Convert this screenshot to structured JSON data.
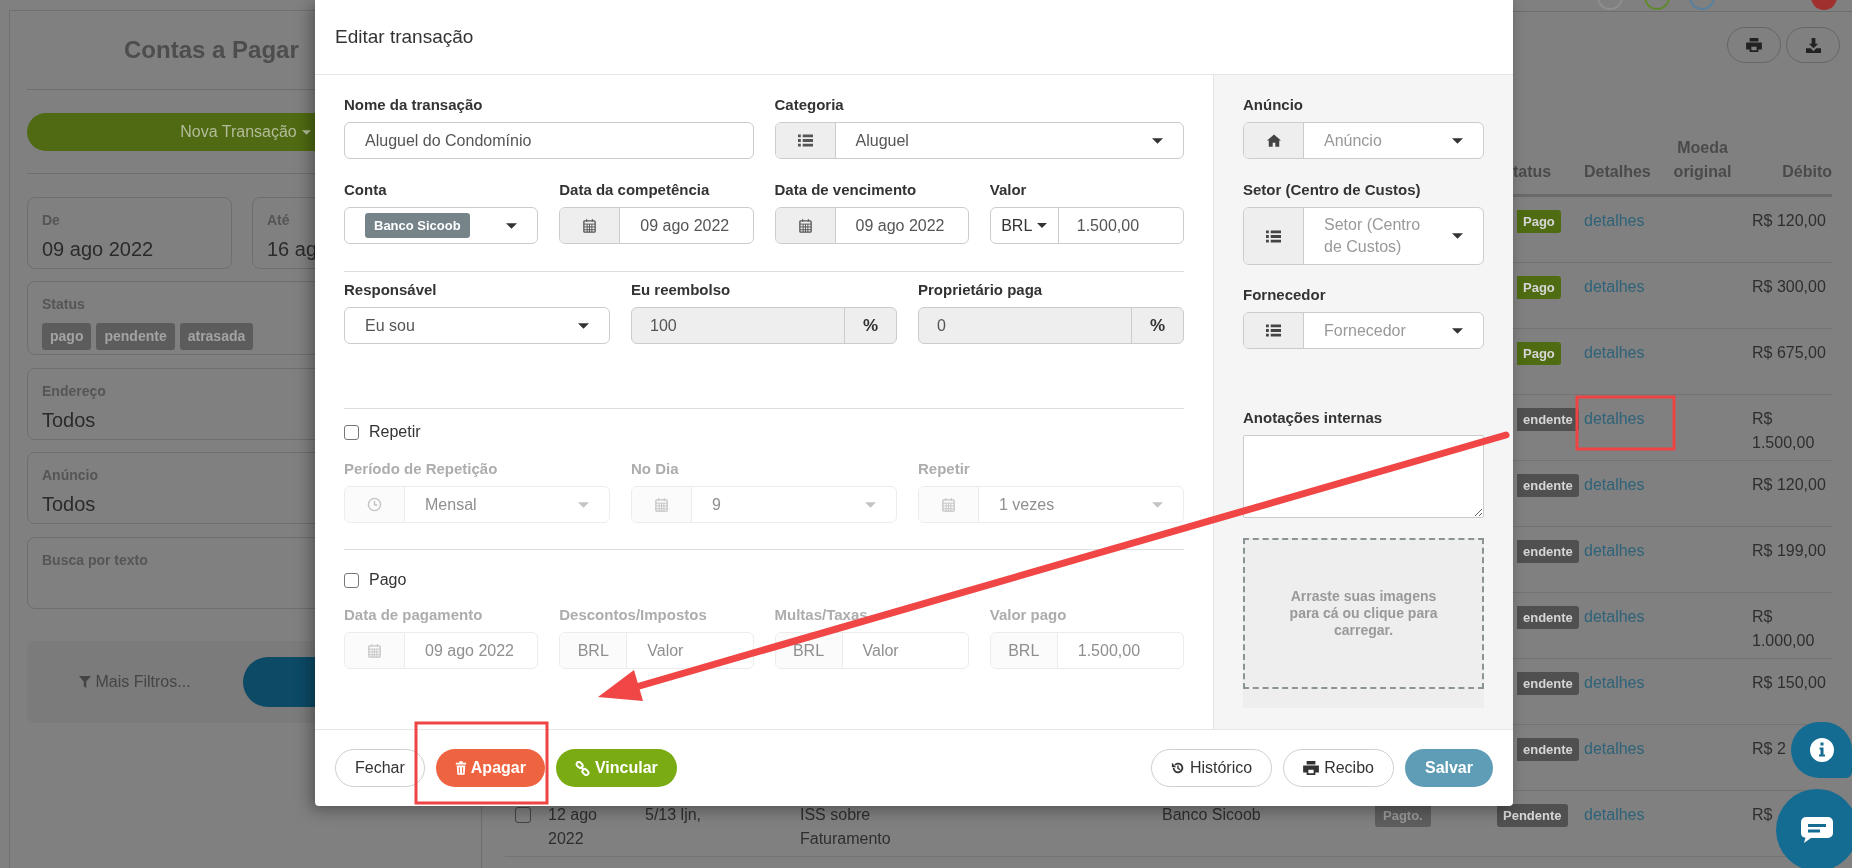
{
  "background": {
    "sidebar": {
      "title": "Contas a Pagar",
      "new_button": "Nova Transação",
      "date_from": {
        "label": "De",
        "value": "09 ago 2022"
      },
      "date_to": {
        "label": "Até",
        "value": "16 ag"
      },
      "status": {
        "label": "Status",
        "tags": [
          "pago",
          "pendente",
          "atrasada"
        ]
      },
      "address": {
        "label": "Endereço",
        "value": "Todos"
      },
      "listing": {
        "label": "Anúncio",
        "value": "Todos"
      },
      "search": {
        "label": "Busca por texto"
      },
      "more_filters": "Mais Filtros..."
    },
    "table": {
      "columns": [
        "tatus",
        "Detalhes",
        "Moeda original",
        "Débito"
      ],
      "rows": [
        {
          "status": "Pago",
          "color": "#4f6c12",
          "details": "detalhes",
          "debit": "R$ 120,00"
        },
        {
          "status": "Pago",
          "color": "#4f6c12",
          "details": "detalhes",
          "debit": "R$ 300,00"
        },
        {
          "status": "Pago",
          "color": "#4f6c12",
          "details": "detalhes",
          "debit": "R$ 675,00"
        },
        {
          "status": "endente",
          "color": "#505050",
          "details": "detalhes",
          "debit": "R$ 1.500,00"
        },
        {
          "status": "endente",
          "color": "#505050",
          "details": "detalhes",
          "debit": "R$ 120,00"
        },
        {
          "status": "endente",
          "color": "#505050",
          "details": "detalhes",
          "debit": "R$ 199,00"
        },
        {
          "status": "endente",
          "color": "#505050",
          "details": "detalhes",
          "debit": "R$ 1.000,00"
        },
        {
          "status": "endente",
          "color": "#505050",
          "details": "detalhes",
          "debit": "R$ 150,00"
        },
        {
          "status": "endente",
          "color": "#505050",
          "details": "detalhes",
          "debit": "R$ 2"
        },
        {
          "checked": false,
          "date": "12 ago 2022",
          "code": "5/13 ljn,",
          "description": "ISS sobre Faturamento",
          "account": "Banco Sicoob",
          "type": "Pagto.",
          "status": "Pendente",
          "color": "#505050",
          "details": "detalhes",
          "debit": "R$"
        }
      ]
    }
  },
  "modal": {
    "title": "Editar transação",
    "name": {
      "label": "Nome da transação",
      "value": "Aluguel do Condomínio"
    },
    "category": {
      "label": "Categoria",
      "value": "Aluguel"
    },
    "account": {
      "label": "Conta",
      "value": "Banco Sicoob"
    },
    "competence_date": {
      "label": "Data da competência",
      "value": "09 ago 2022"
    },
    "due_date": {
      "label": "Data de vencimento",
      "value": "09 ago 2022"
    },
    "amount": {
      "label": "Valor",
      "currency": "BRL",
      "value": "1.500,00"
    },
    "responsible": {
      "label": "Responsável",
      "value": "Eu sou"
    },
    "reimburse": {
      "label": "Eu reembolso",
      "value": "100",
      "unit": "%"
    },
    "owner_pays": {
      "label": "Proprietário paga",
      "value": "0",
      "unit": "%"
    },
    "repeat": {
      "label": "Repetir",
      "checked": false,
      "fields": [
        {
          "label": "Período de Repetição",
          "kind": "period",
          "value": "Mensal"
        },
        {
          "label": "No Dia",
          "kind": "day",
          "value": "9"
        },
        {
          "label": "Repetir",
          "kind": "count",
          "value": "1 vezes"
        }
      ]
    },
    "paid": {
      "label": "Pago",
      "checked": false,
      "fields": [
        {
          "label": "Data de pagamento",
          "kind": "date",
          "value": "09 ago 2022"
        },
        {
          "label": "Descontos/Impostos",
          "kind": "money",
          "currency": "BRL",
          "placeholder": "Valor"
        },
        {
          "label": "Multas/Taxas",
          "kind": "money",
          "currency": "BRL",
          "placeholder": "Valor"
        },
        {
          "label": "Valor pago",
          "kind": "money",
          "currency": "BRL",
          "value": "1.500,00"
        }
      ]
    },
    "listing": {
      "label": "Anúncio",
      "placeholder": "Anúncio"
    },
    "cost_center": {
      "label": "Setor (Centro de Custos)",
      "placeholder": "Setor (Centro de Custos)"
    },
    "supplier": {
      "label": "Fornecedor",
      "placeholder": "Fornecedor"
    },
    "notes": {
      "label": "Anotações internas"
    },
    "dropzone": "Arraste suas imagens para cá ou clique para carregar.",
    "buttons_left": [
      {
        "label": "Fechar",
        "kind": "close"
      },
      {
        "label": "Apagar",
        "kind": "delete"
      },
      {
        "label": "Vincular",
        "kind": "link"
      }
    ],
    "buttons_right": [
      {
        "label": "Histórico",
        "kind": "history"
      },
      {
        "label": "Recibo",
        "kind": "receipt"
      },
      {
        "label": "Salvar",
        "kind": "save"
      }
    ]
  }
}
